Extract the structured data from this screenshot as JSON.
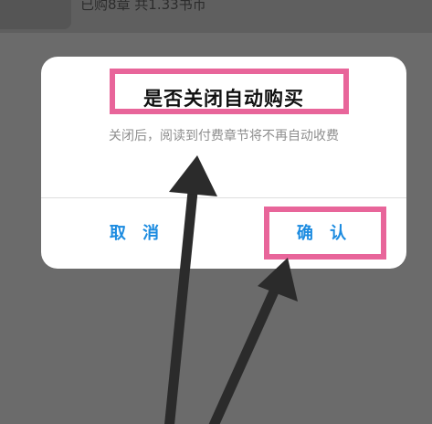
{
  "header": {
    "purchase_summary": "已购8章 共1.33书币"
  },
  "dialog": {
    "title": "是否关闭自动购买",
    "message": "关闭后，阅读到付费章节将不再自动收费",
    "cancel_label": "取 消",
    "confirm_label": "确 认"
  },
  "colors": {
    "overlay": "#6b6b6b",
    "highlight": "#e8659a",
    "button_text": "#1b8be0",
    "arrow": "#2b2b2b"
  }
}
